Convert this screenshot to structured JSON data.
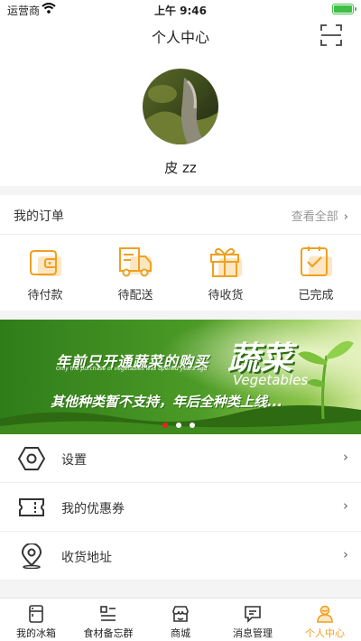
{
  "status_bar": {
    "carrier": "运营商",
    "time": "上午 9:46"
  },
  "header": {
    "title": "个人中心",
    "scan_icon": "scan-icon"
  },
  "profile": {
    "name": "皮 zz"
  },
  "orders": {
    "title": "我的订单",
    "view_all": "查看全部",
    "items": [
      {
        "label": "待付款",
        "icon": "wallet-icon"
      },
      {
        "label": "待配送",
        "icon": "delivery-truck-icon"
      },
      {
        "label": "待收货",
        "icon": "gift-box-icon"
      },
      {
        "label": "已完成",
        "icon": "checked-clipboard-icon"
      }
    ]
  },
  "banner": {
    "line1": "年前只开通蔬菜的购买",
    "line1_en": "Only the purchase of vegetables was opened years ago",
    "title": "蔬菜",
    "title_en": "Vegetables",
    "line2": "其他种类暂不支持，年后全种类上线...",
    "dots_count": 3,
    "active_index": 0
  },
  "menu": [
    {
      "label": "设置",
      "icon": "gear-hexagon-icon"
    },
    {
      "label": "我的优惠券",
      "icon": "coupon-icon"
    },
    {
      "label": "收货地址",
      "icon": "location-pin-icon"
    }
  ],
  "tabbar": [
    {
      "label": "我的冰箱",
      "icon": "fridge-icon"
    },
    {
      "label": "食材备忘群",
      "icon": "list-icon"
    },
    {
      "label": "商城",
      "icon": "store-icon"
    },
    {
      "label": "消息管理",
      "icon": "message-icon"
    },
    {
      "label": "个人中心",
      "icon": "person-icon",
      "active": true
    }
  ],
  "colors": {
    "accent": "#f0a020",
    "dot_active": "#e8231f",
    "battery": "#3fbf4a"
  }
}
